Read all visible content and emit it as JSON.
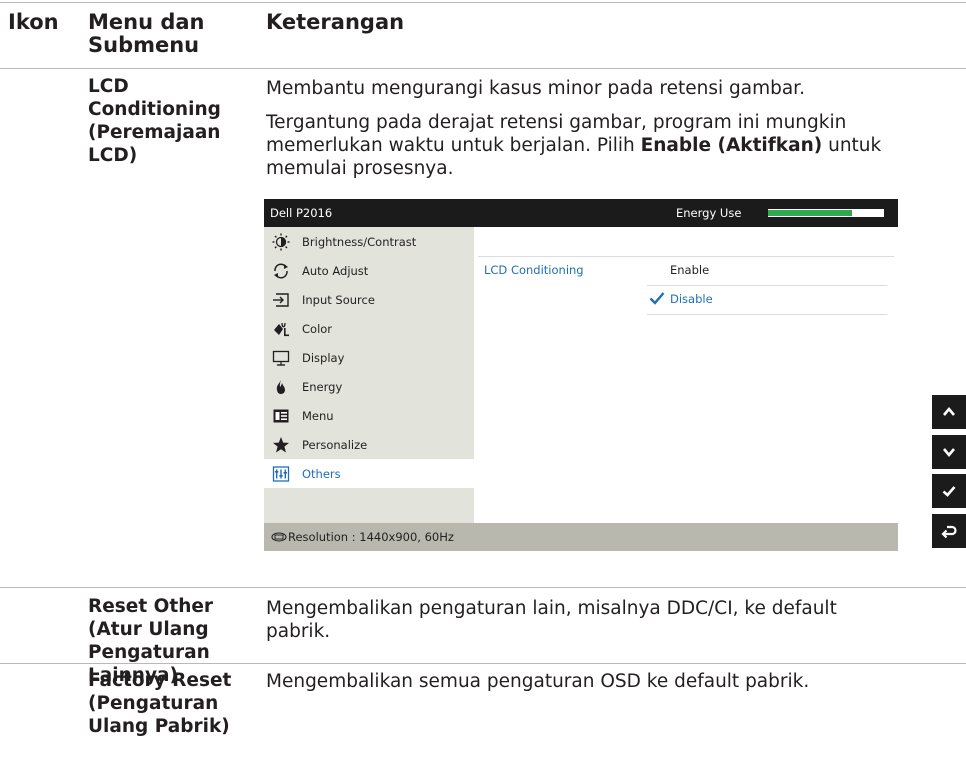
{
  "header": {
    "icon_col": "Ikon",
    "menu_col": "Menu dan Submenu",
    "menu_col_line1": "Menu dan",
    "menu_col_line2": "Submenu",
    "desc_col": "Keterangan"
  },
  "rows": [
    {
      "menu_lines": [
        "LCD",
        "Conditioning",
        "(Peremajaan",
        "LCD)"
      ],
      "desc_p1": "Membantu mengurangi kasus minor pada retensi gambar.",
      "desc_p2_line1": "Tergantung pada derajat retensi gambar, program ini mungkin",
      "desc_p2_line2_pre": "memerlukan waktu untuk berjalan. Pilih ",
      "desc_p2_line2_bold": "Enable (Aktifkan)",
      "desc_p2_line2_post": " untuk",
      "desc_p2_line3": "memulai prosesnya."
    },
    {
      "menu_lines": [
        "Reset Other",
        "(Atur Ulang",
        "Pengaturan",
        "Lainnya)"
      ],
      "desc_line1": "Mengembalikan pengaturan lain, misalnya DDC/CI, ke default",
      "desc_line2": "pabrik."
    },
    {
      "menu_lines": [
        "Factory Reset",
        "(Pengaturan",
        "Ulang Pabrik)"
      ],
      "desc_line1": "Mengembalikan semua pengaturan OSD ke default pabrik."
    }
  ],
  "osd": {
    "model": "Dell P2016",
    "energy_label": "Energy Use",
    "energy_level": 0.72,
    "menu_items": [
      {
        "label": "Brightness/Contrast",
        "icon": "brightness-icon"
      },
      {
        "label": "Auto Adjust",
        "icon": "auto-adjust-icon"
      },
      {
        "label": "Input Source",
        "icon": "input-source-icon"
      },
      {
        "label": "Color",
        "icon": "color-icon"
      },
      {
        "label": "Display",
        "icon": "display-icon"
      },
      {
        "label": "Energy",
        "icon": "energy-icon"
      },
      {
        "label": "Menu",
        "icon": "menu-icon"
      },
      {
        "label": "Personalize",
        "icon": "star-icon"
      },
      {
        "label": "Others",
        "icon": "others-icon",
        "selected": true
      }
    ],
    "submenu_label": "LCD Conditioning",
    "option_enable": "Enable",
    "option_disable": "Disable",
    "resolution": "Resolution : 1440x900, 60Hz"
  },
  "side_buttons": [
    "up-icon",
    "down-icon",
    "check-icon",
    "back-icon"
  ],
  "colors": {
    "accent_blue": "#1f6fb5",
    "energy_green": "#2fa84f",
    "osd_dark": "#1b1b1b",
    "osd_menu_bg": "#e2e3da"
  }
}
